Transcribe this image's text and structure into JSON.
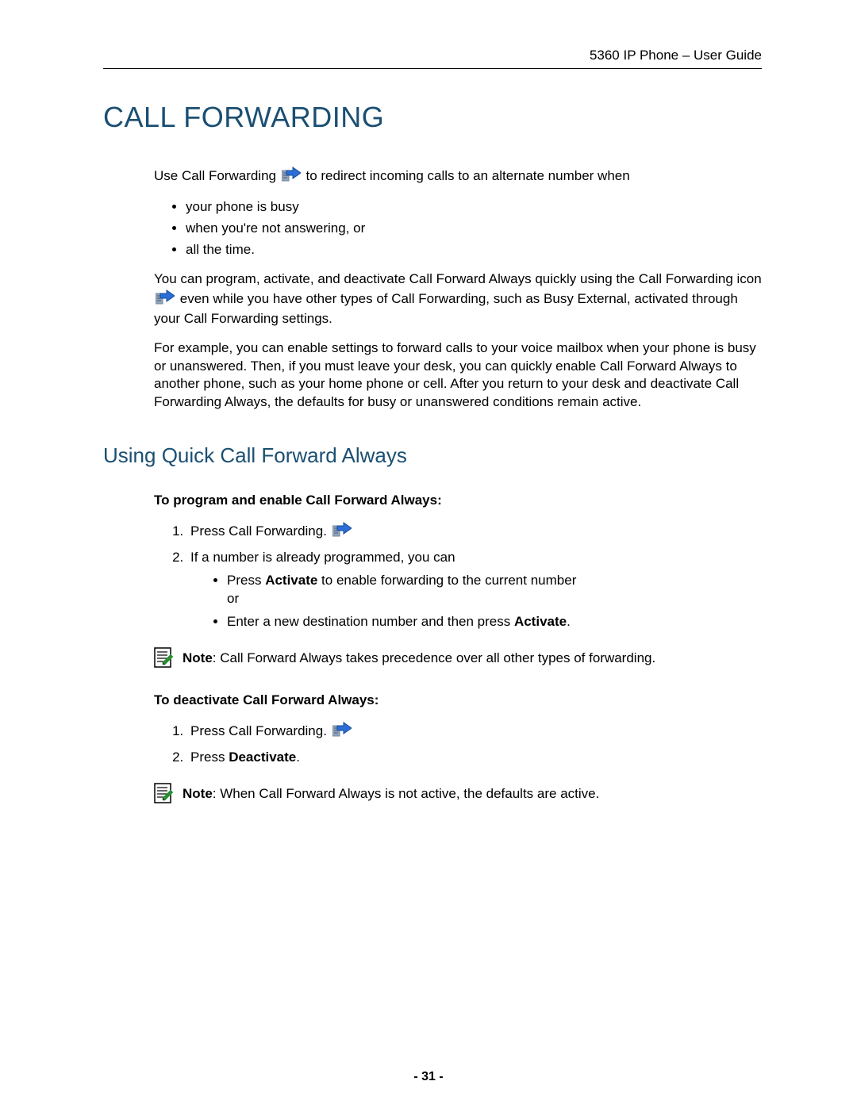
{
  "header": {
    "doc_title": "5360 IP Phone – User Guide"
  },
  "title": "CALL FORWARDING",
  "intro": {
    "line1_a": "Use Call Forwarding ",
    "line1_b": " to redirect incoming calls to an alternate number when",
    "bullets": [
      "your phone is busy",
      "when you're not answering, or",
      "all the time."
    ],
    "para2_a": "You can program, activate, and deactivate Call Forward Always quickly using the Call Forwarding icon ",
    "para2_b": " even while you have other types of Call Forwarding, such as Busy External, activated through your Call Forwarding settings.",
    "para3": "For example, you can enable settings to forward calls to your voice mailbox when your phone is busy or unanswered. Then, if you must leave your desk, you can quickly enable Call Forward Always to another phone, such as your home phone or cell. After you return to your desk and deactivate Call Forwarding Always, the defaults for busy or unanswered conditions remain active."
  },
  "section2": {
    "heading": "Using Quick Call Forward Always",
    "sub1": "To program and enable Call Forward Always:",
    "steps1": {
      "s1": "Press Call Forwarding. ",
      "s2": "If a number is already programmed, you can",
      "s2_sub_a_pre": "Press ",
      "s2_sub_a_bold": "Activate",
      "s2_sub_a_post": " to enable forwarding to the current number",
      "s2_sub_a_or": "or",
      "s2_sub_b_pre": "Enter a new destination number and then press ",
      "s2_sub_b_bold": "Activate",
      "s2_sub_b_post": "."
    },
    "note1_label": "Note",
    "note1_text": ": Call Forward Always takes precedence over all other types of forwarding.",
    "sub2": "To deactivate Call Forward Always:",
    "steps2": {
      "s1": "Press Call Forwarding. ",
      "s2_pre": "Press ",
      "s2_bold": "Deactivate",
      "s2_post": "."
    },
    "note2_label": "Note",
    "note2_text": ": When Call Forward Always is not active, the defaults are active."
  },
  "footer": {
    "page_number": "- 31 -"
  }
}
